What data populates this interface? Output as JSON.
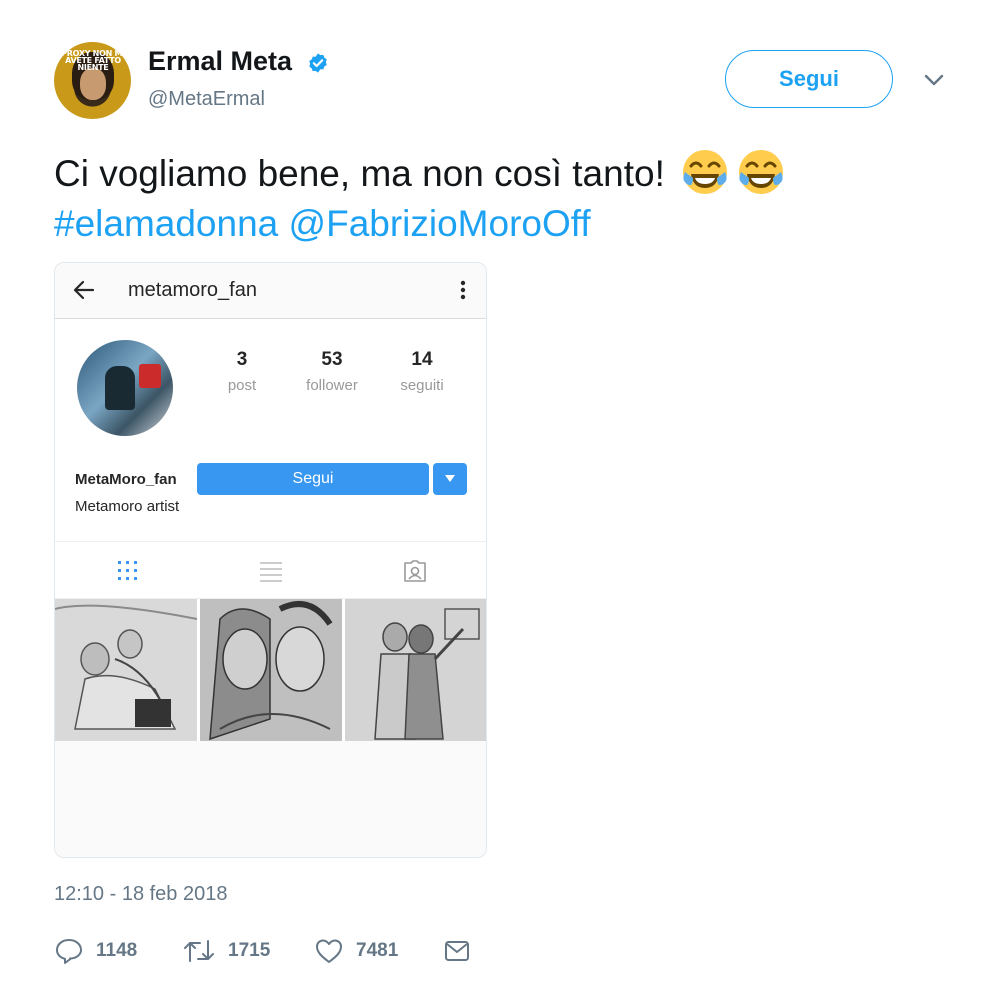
{
  "user": {
    "display_name": "Ermal Meta",
    "handle": "@MetaErmal",
    "verified": true,
    "avatar_banner_text": "PROXY NON MI AVETE FATTO NIENTE"
  },
  "follow_button": {
    "label": "Segui"
  },
  "tweet": {
    "text": "Ci vogliamo bene, ma non così tanto!",
    "emojis": [
      "face-with-tears-of-joy",
      "face-with-tears-of-joy"
    ],
    "hashtag": "#elamadonna",
    "mention": "@FabrizioMoroOff",
    "timestamp": "12:10 - 18 feb 2018"
  },
  "embedded_screenshot": {
    "username": "metamoro_fan",
    "stats": [
      {
        "value": "3",
        "label": "post"
      },
      {
        "value": "53",
        "label": "follower"
      },
      {
        "value": "14",
        "label": "seguiti"
      }
    ],
    "follow_label": "Segui",
    "display_name": "MetaMoro_fan",
    "bio": "Metamoro artist",
    "tabs": [
      "grid-icon",
      "list-icon",
      "tagged-icon"
    ]
  },
  "actions": {
    "replies": "1148",
    "retweets": "1715",
    "likes": "7481"
  },
  "colors": {
    "accent": "#1da1f2",
    "text": "#14171a",
    "muted": "#657786",
    "ig_blue": "#3897f0"
  }
}
